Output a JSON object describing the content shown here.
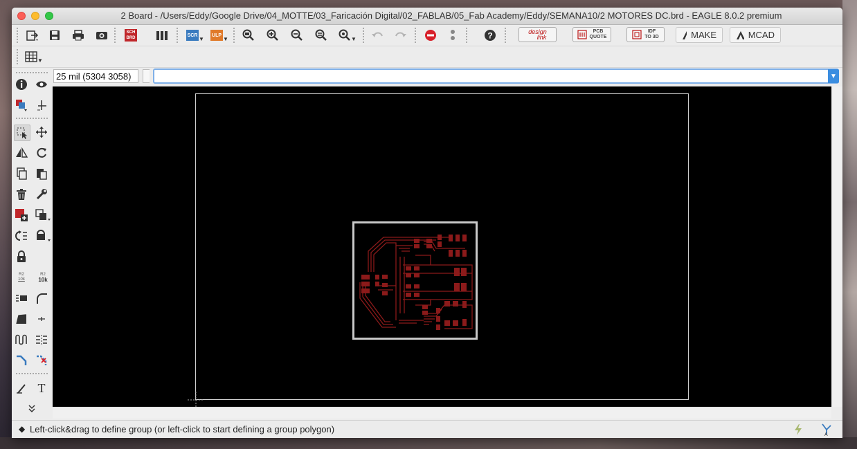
{
  "window": {
    "title": "2 Board - /Users/Eddy/Google Drive/04_MOTTE/03_Faricación Digital/02_FABLAB/05_Fab Academy/Eddy/SEMANA10/2 MOTORES DC.brd - EAGLE 8.0.2 premium"
  },
  "toolbar": {
    "sch_brd_label_top": "SCH",
    "sch_brd_label_bottom": "BRD",
    "scr_label": "SCR",
    "ulp_label": "ULP",
    "designlink_label_top": "design",
    "designlink_label_bottom": "link",
    "pcb_quote_label_top": "PCB",
    "pcb_quote_label_bottom": "QUOTE",
    "idf_label_top": "IDF",
    "idf_label_bottom": "TO 3D",
    "make_label": "MAKE",
    "mcad_label": "MCAD"
  },
  "leftbar": {
    "value_label_top": "R2",
    "value_label_bottom": "10k",
    "value2_label_top": "R2",
    "value2_label_bottom": "10k",
    "text_tool_glyph": "T"
  },
  "command": {
    "coordinates": "25 mil (5304 3058)",
    "input_value": ""
  },
  "status": {
    "message": "Left-click&drag to define group (or left-click to start defining a group polygon)"
  },
  "colors": {
    "canvas_bg": "#000000",
    "trace_color": "#8b1a1a",
    "board_outline": "#c8c8c8",
    "frame_color": "#cfcfcf"
  }
}
